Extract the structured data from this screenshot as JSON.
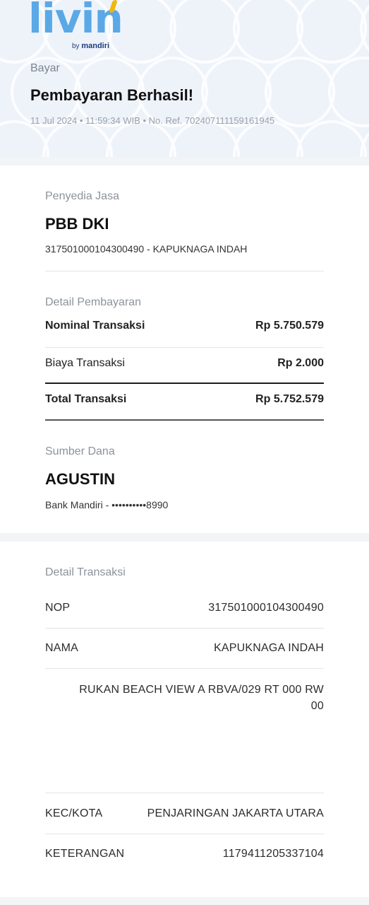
{
  "brand": {
    "logo_text": "livin",
    "by_text": "by",
    "bank_text": "mandiri",
    "primary_color": "#5ba8e6",
    "accent_color": "#f1b70d"
  },
  "header": {
    "kicker": "Bayar",
    "title": "Pembayaran Berhasil!",
    "meta": "11 Jul 2024 • 11:59:34 WIB • No. Ref. 702407111159161945"
  },
  "provider": {
    "label": "Penyedia Jasa",
    "name": "PBB DKI",
    "detail": "317501000104300490 - KAPUKNAGA INDAH"
  },
  "payment": {
    "label": "Detail Pembayaran",
    "rows": [
      {
        "key": "Nominal Transaksi",
        "value": "Rp 5.750.579"
      },
      {
        "key": "Biaya Transaksi",
        "value": "Rp 2.000"
      },
      {
        "key": "Total Transaksi",
        "value": "Rp 5.752.579"
      }
    ]
  },
  "source": {
    "label": "Sumber Dana",
    "name": "AGUSTIN",
    "detail": "Bank Mandiri - ••••••••••8990"
  },
  "transaction": {
    "label": "Detail Transaksi",
    "nop_key": "NOP",
    "nop_value": "317501000104300490",
    "nama_key": "NAMA",
    "nama_value": "KAPUKNAGA INDAH",
    "address_line1": "RUKAN BEACH VIEW A RBVA/029 RT 000 RW",
    "address_line2": "00",
    "kec_key": "KEC/KOTA",
    "kec_value": "PENJARINGAN JAKARTA UTARA",
    "ket_key": "KETERANGAN",
    "ket_value": "1179411205337104"
  }
}
